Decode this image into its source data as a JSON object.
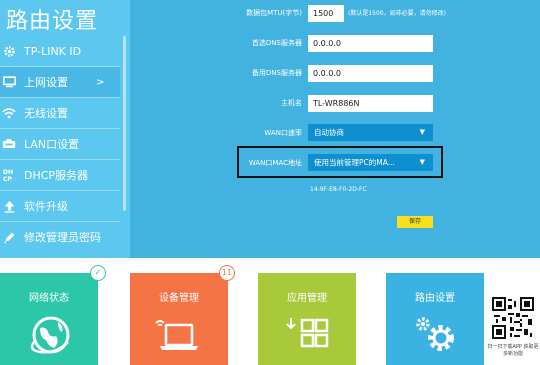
{
  "sidebar": {
    "title": "路由设置",
    "items": [
      {
        "label": "TP-LINK ID",
        "icon": "gear-icon"
      },
      {
        "label": "上网设置",
        "icon": "monitor-icon",
        "chevron": ">"
      },
      {
        "label": "无线设置",
        "icon": "wifi-icon"
      },
      {
        "label": "LAN口设置",
        "icon": "lan-icon"
      },
      {
        "label": "DHCP服务器",
        "icon": "dhcp-icon"
      },
      {
        "label": "软件升级",
        "icon": "upgrade-icon"
      },
      {
        "label": "修改管理员密码",
        "icon": "pencil-icon"
      }
    ]
  },
  "form": {
    "mtu_label": "数据包MTU(字节)",
    "mtu_value": "1500",
    "mtu_hint": "(默认是1500，如非必要，请勿修改)",
    "dns1_label": "首选DNS服务器",
    "dns1_value": "0.0.0.0",
    "dns2_label": "备用DNS服务器",
    "dns2_value": "0.0.0.0",
    "host_label": "主机名",
    "host_value": "TL-WR886N",
    "wan_rate_label": "WAN口速率",
    "wan_rate_value": "自动协商",
    "wan_mac_label": "WAN口MAC地址",
    "wan_mac_value": "使用当前管理PC的MA...",
    "mac_address": "14-9F-E8-F0-2D-FC",
    "save_label": "保存"
  },
  "tiles": [
    {
      "label": "网络状态",
      "color": "#2cc7a8",
      "badge": "✓"
    },
    {
      "label": "设备管理",
      "color": "#f47446",
      "badge": "11"
    },
    {
      "label": "应用管理",
      "color": "#a8c93a"
    },
    {
      "label": "路由设置",
      "color": "#3ab2e2"
    }
  ],
  "qr_caption": "扫一扫下载APP 获取更多新功能"
}
